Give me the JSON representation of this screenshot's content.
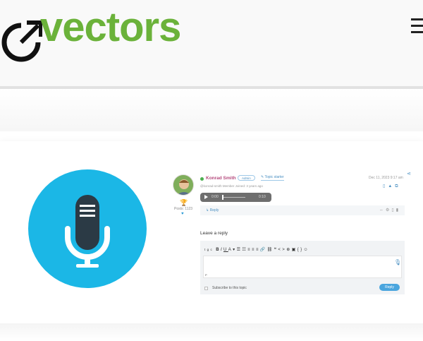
{
  "brand": {
    "logo_text": "vectors",
    "color": "#6bb23a"
  },
  "header": {
    "menu_icon": "hamburger-icon"
  },
  "post": {
    "author": "Konrad Smith",
    "role_badge": "Admin",
    "topic_starter": "Topic starter",
    "meta": "@konrad-smith  Member  Joined: 3 years ago",
    "date": "Dec 11, 2023 9:17 am",
    "posts_count": "Posts: 1123",
    "audio": {
      "current": "0:00",
      "duration": "0:10",
      "progress": 0
    },
    "reply_link": "Reply",
    "accent": "#4a90c2"
  },
  "reply_form": {
    "title": "Leave a reply",
    "toolbar_items": [
      "tgc",
      "B",
      "I",
      "U",
      "A",
      "▾",
      "☰",
      "☷",
      "≡",
      "≡",
      "≡",
      "🔗",
      "⛓",
      "❝",
      "<>",
      "⊕",
      "▣",
      "{}",
      "☺"
    ],
    "textarea_label": "P",
    "subscribe_label": "Subscribe to this topic",
    "submit_label": "Reply",
    "button_color": "#4aa5de"
  },
  "hero": {
    "icon": "microphone-icon",
    "circle_color": "#1bb7e6"
  }
}
